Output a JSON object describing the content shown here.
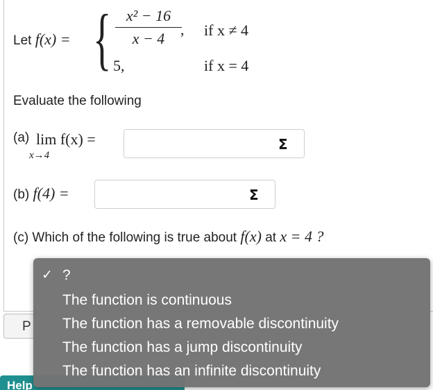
{
  "definition": {
    "label_prefix": "Let",
    "fx": "f(x) =",
    "numerator": "x² − 16",
    "denominator": "x − 4",
    "comma": ",",
    "case2_value": "5,",
    "cond1": "if x ≠ 4",
    "cond2": "if x = 4"
  },
  "instructions": "Evaluate the following",
  "part_a": {
    "label": "(a)",
    "lim_expr": "lim f(x) =",
    "lim_sub": "x→4",
    "input_value": "",
    "sigma_icon": "Σ"
  },
  "part_b": {
    "label": "(b)",
    "expr": "f(4) =",
    "input_value": "",
    "sigma_icon": "Σ"
  },
  "part_c": {
    "question": "(c) Which of the following is true about",
    "fx": "f(x)",
    "at": "at",
    "x_eq": "x = 4 ?"
  },
  "dropdown": {
    "check_icon": "✓",
    "options": [
      "?",
      "The function is continuous",
      "The function has a removable discontinuity",
      "The function has a jump discontinuity",
      "The function has an infinite discontinuity"
    ],
    "selected_index": 0
  },
  "side_button_label": "P",
  "help_bar_label": "Help"
}
